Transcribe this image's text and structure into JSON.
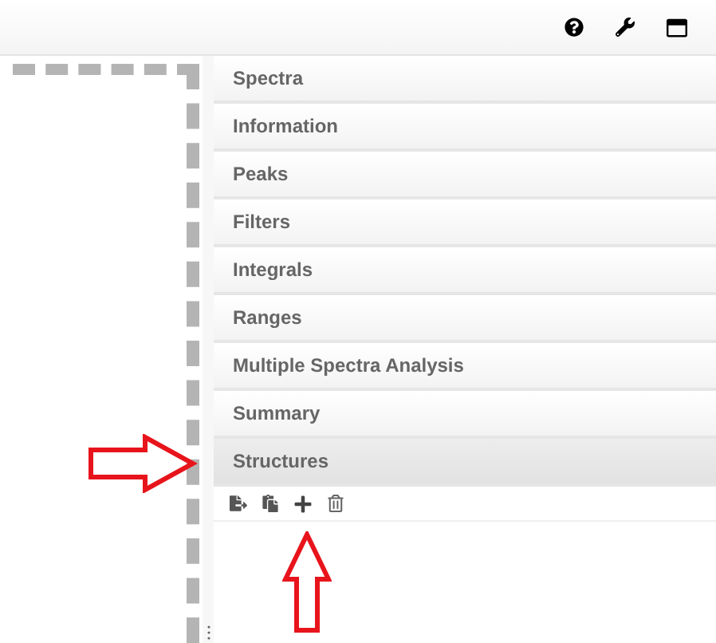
{
  "sections": [
    {
      "label": "Spectra",
      "expanded": false
    },
    {
      "label": "Information",
      "expanded": false
    },
    {
      "label": "Peaks",
      "expanded": false
    },
    {
      "label": "Filters",
      "expanded": false
    },
    {
      "label": "Integrals",
      "expanded": false
    },
    {
      "label": "Ranges",
      "expanded": false
    },
    {
      "label": "Multiple Spectra Analysis",
      "expanded": false
    },
    {
      "label": "Summary",
      "expanded": false
    },
    {
      "label": "Structures",
      "expanded": true
    }
  ]
}
